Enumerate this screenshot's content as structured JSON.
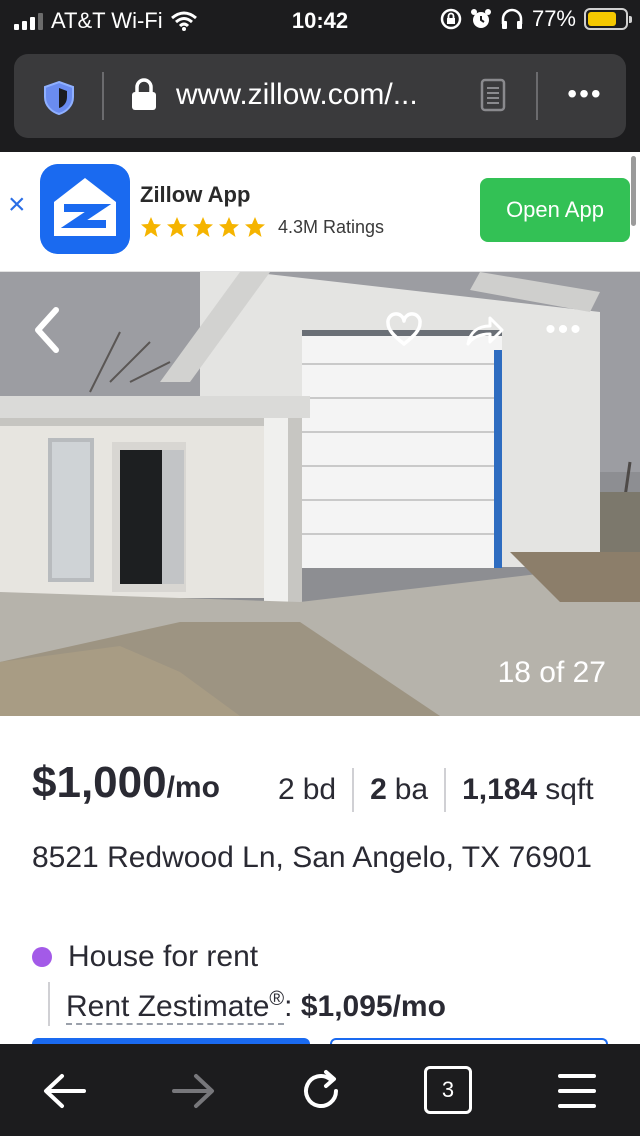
{
  "status_bar": {
    "carrier": "AT&T Wi-Fi",
    "time": "10:42",
    "battery_percent": "77%",
    "battery_level": 0.77,
    "icons": [
      "signal-icon",
      "wifi-icon",
      "orientation-lock-icon",
      "alarm-icon",
      "headphones-icon",
      "battery-icon"
    ]
  },
  "browser": {
    "url": "www.zillow.com/...",
    "icons": [
      "shield-icon",
      "lock-icon",
      "reader-mode-icon",
      "more-icon"
    ],
    "more_label": "•••"
  },
  "app_banner": {
    "close_label": "×",
    "app_name": "Zillow App",
    "stars": 5,
    "ratings_text": "4.3M Ratings",
    "open_label": "Open App"
  },
  "photo": {
    "counter": "18 of 27",
    "more_label": "•••",
    "icons": [
      "back-icon",
      "heart-icon",
      "share-icon",
      "more-icon"
    ]
  },
  "listing": {
    "price": "$1,000",
    "price_unit": "/mo",
    "beds_value": "2",
    "beds_unit": "bd",
    "baths_value": "2",
    "baths_unit": "ba",
    "sqft_value": "1,184",
    "sqft_unit": "sqft",
    "address": "8521 Redwood Ln, San Angelo, TX 76901",
    "home_type": "House for rent",
    "zestimate_label": "Rent Zestimate",
    "zestimate_mark": "®",
    "zestimate_sep": ": ",
    "zestimate_value": "$1,095/mo"
  },
  "toolbar": {
    "tabs_count": "3",
    "icons": [
      "back-arrow-icon",
      "forward-arrow-icon",
      "reload-icon",
      "tabs-icon",
      "menu-icon"
    ]
  },
  "colors": {
    "zillow_blue": "#1a6af0",
    "open_app_green": "#33c155",
    "type_dot": "#a35ae8",
    "battery": "#f5c800"
  }
}
